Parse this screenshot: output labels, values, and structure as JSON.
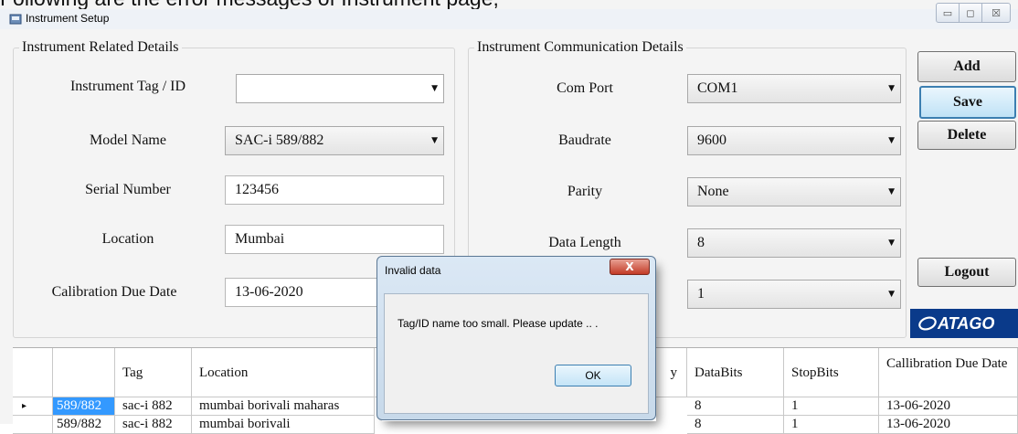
{
  "caption": "Following are the error messages of Instrument page;",
  "window": {
    "title": "Instrument Setup",
    "controls": [
      "▭",
      "◻",
      "☒"
    ]
  },
  "related": {
    "title": "Instrument Related Details",
    "tag_label": "Instrument Tag / ID",
    "tag_value": "",
    "model_label": "Model Name",
    "model_value": "SAC-i 589/882",
    "serial_label": "Serial Number",
    "serial_value": "123456",
    "location_label": "Location",
    "location_value": "Mumbai",
    "caldate_label": "Calibration Due Date",
    "caldate_value": "13-06-2020"
  },
  "comm": {
    "title": "Instrument Communication Details",
    "comport_label": "Com Port",
    "comport_value": "COM1",
    "baud_label": "Baudrate",
    "baud_value": "9600",
    "parity_label": "Parity",
    "parity_value": "None",
    "datalen_label": "Data Length",
    "datalen_value": "8",
    "stopbits_label": "",
    "stopbits_value": "1"
  },
  "buttons": {
    "add": "Add",
    "save": "Save",
    "delete": "Delete",
    "logout": "Logout"
  },
  "logo_text": "ATAGO",
  "grid": {
    "headers": [
      "",
      "",
      "Tag",
      "Location",
      "",
      "",
      "y",
      "DataBits",
      "StopBits",
      "Callibration Due Date"
    ],
    "rows": [
      {
        "marker": "▸",
        "model": "589/882",
        "tag": "sac-i 882",
        "location": "mumbai borivali maharas",
        "databits": "8",
        "stopbits": "1",
        "duedate": "13-06-2020"
      },
      {
        "marker": "",
        "model": "589/882",
        "tag": "sac-i 882",
        "location": "mumbai borivali",
        "databits": "8",
        "stopbits": "1",
        "duedate": "13-06-2020"
      }
    ]
  },
  "dialog": {
    "title": "Invalid data",
    "message": "Tag/ID name too small. Please update .. .",
    "ok": "OK",
    "close": "X"
  },
  "colors": {
    "selection": "#3399ff",
    "logo_bg": "#0a3a8a",
    "dialog_frame": "#c7d9ea"
  }
}
